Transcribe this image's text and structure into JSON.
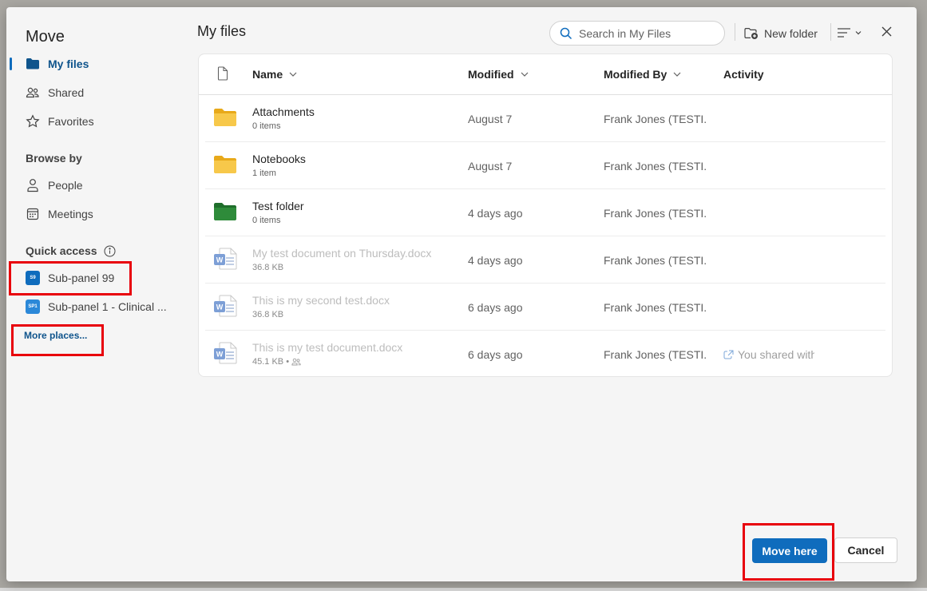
{
  "dialog": {
    "title": "Move",
    "nav": [
      {
        "label": "My files",
        "icon": "folder-icon",
        "active": true
      },
      {
        "label": "Shared",
        "icon": "people-icon"
      },
      {
        "label": "Favorites",
        "icon": "star-icon"
      }
    ],
    "browse_by": {
      "label": "Browse by",
      "items": [
        {
          "label": "People",
          "icon": "person-icon"
        },
        {
          "label": "Meetings",
          "icon": "calendar-icon"
        }
      ]
    },
    "quick_access": {
      "label": "Quick access",
      "info_icon": "info-icon",
      "items": [
        {
          "label": "Sub-panel 99",
          "badge": "S9",
          "color": "#0f6cbd"
        },
        {
          "label": "Sub-panel 1 - Clinical ...",
          "badge": "SP1",
          "color": "#2b88d8"
        }
      ],
      "more_places": "More places..."
    }
  },
  "header": {
    "title": "My files",
    "search_placeholder": "Search in My Files",
    "new_folder_label": "New folder"
  },
  "table": {
    "columns": [
      "Name",
      "Modified",
      "Modified By",
      "Activity"
    ],
    "rows": [
      {
        "name": "Attachments",
        "meta": "0 items",
        "modified": "August 7",
        "modified_by": "Frank Jones (TESTI...",
        "activity": "",
        "type": "folder-yellow"
      },
      {
        "name": "Notebooks",
        "meta": "1 item",
        "modified": "August 7",
        "modified_by": "Frank Jones (TESTI...",
        "activity": "",
        "type": "folder-yellow"
      },
      {
        "name": "Test folder",
        "meta": "0 items",
        "modified": "4 days ago",
        "modified_by": "Frank Jones (TESTI...",
        "activity": "",
        "type": "folder-green"
      },
      {
        "name": "My test document on Thursday.docx",
        "meta": "36.8 KB",
        "modified": "4 days ago",
        "modified_by": "Frank Jones (TESTI...",
        "activity": "",
        "type": "word"
      },
      {
        "name": "This is my second test.docx",
        "meta": "36.8 KB",
        "modified": "6 days ago",
        "modified_by": "Frank Jones (TESTI...",
        "activity": "",
        "type": "word"
      },
      {
        "name": "This is my test document.docx",
        "meta": "45.1 KB •",
        "modified": "6 days ago",
        "modified_by": "Frank Jones (TESTI...",
        "activity": "You shared with",
        "type": "word",
        "shared": true
      }
    ]
  },
  "footer": {
    "primary_label": "Move here",
    "secondary_label": "Cancel"
  },
  "colors": {
    "accent": "#0f6cbd",
    "highlight": "#e8000b",
    "folder_yellow": "#f7c84a",
    "folder_green": "#2e8b3a"
  }
}
